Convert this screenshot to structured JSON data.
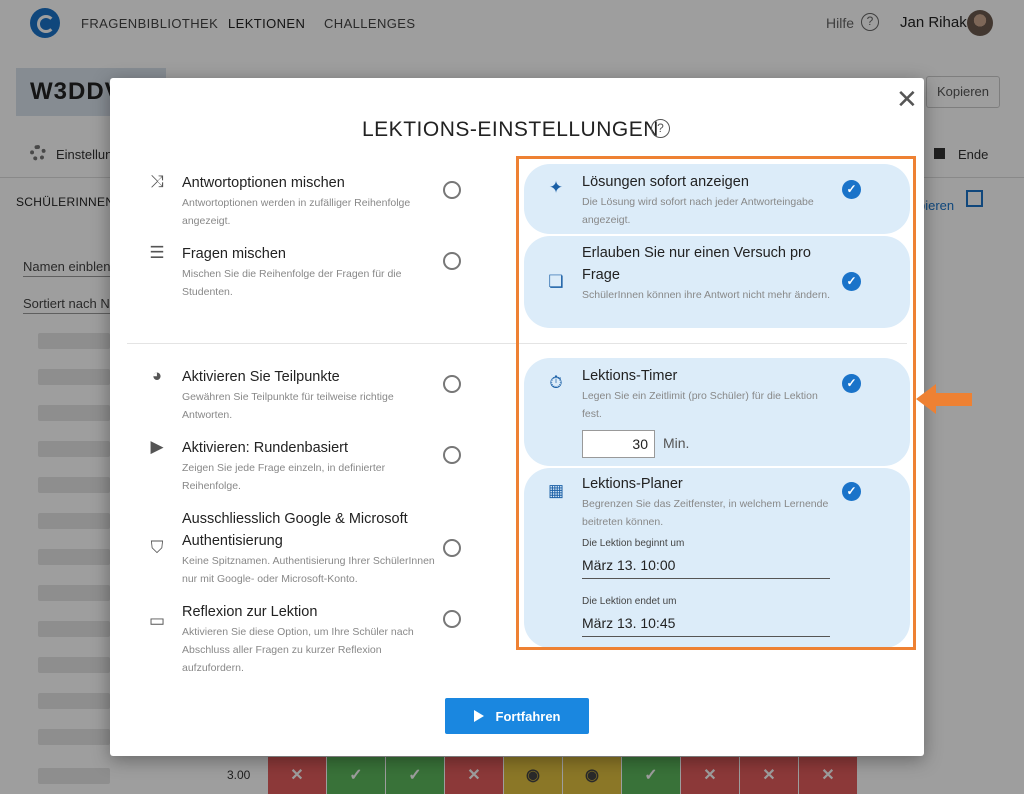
{
  "nav": {
    "links": [
      "FRAGENBIBLIOTHEK",
      "LEKTIONEN",
      "CHALLENGES"
    ],
    "help": "Hilfe",
    "user": "Jan Rihak"
  },
  "page": {
    "lesson_code": "W3DDV",
    "copy_button": "Kopieren",
    "settings_tab": "Einstellun",
    "end_label": "Ende",
    "students_header": "SCHÜLERINNEN",
    "copy_link": "pieren",
    "show_names": "Namen einblen",
    "sorted_by": "Sortiert nach Na",
    "score": "3.00",
    "results": [
      "wrong",
      "right",
      "right",
      "wrong",
      "seen",
      "seen",
      "right",
      "wrong",
      "wrong",
      "wrong"
    ]
  },
  "modal": {
    "title": "LEKTIONS-EINSTELLUNGEN",
    "left_options": [
      {
        "title": "Antwortoptionen mischen",
        "desc": "Antwortoptionen werden in zufälliger Reihenfolge angezeigt.",
        "icon": "shuffle-icon"
      },
      {
        "title": "Fragen mischen",
        "desc": "Mischen Sie die Reihenfolge der Fragen für die Studenten.",
        "icon": "playlist-remove-icon"
      },
      {
        "title": "Aktivieren Sie Teilpunkte",
        "desc": "Gewähren Sie Teilpunkte für teilweise richtige Antworten.",
        "icon": "pie-chart-icon"
      },
      {
        "title": "Aktivieren: Rundenbasiert",
        "desc": "Zeigen Sie jede Frage einzeln, in definierter Reihenfolge.",
        "icon": "play-circle-icon"
      },
      {
        "title": "Ausschliesslich Google & Microsoft Authentisierung",
        "desc": "Keine Spitznamen. Authentisierung Ihrer SchülerInnen nur mit Google- oder Microsoft-Konto.",
        "icon": "shield-check-icon"
      },
      {
        "title": "Reflexion zur Lektion",
        "desc": "Aktivieren Sie diese Option, um Ihre Schüler nach Abschluss aller Fragen zu kurzer Reflexion aufzufordern.",
        "icon": "chat-icon"
      }
    ],
    "right_options": [
      {
        "title": "Lösungen sofort anzeigen",
        "desc": "Die Lösung wird sofort nach jeder Antworteingabe angezeigt.",
        "icon": "sparkle-icon",
        "checked": true
      },
      {
        "title": "Erlauben Sie nur einen Versuch pro Frage",
        "desc": "SchülerInnen können ihre Antwort nicht mehr ändern.",
        "icon": "filter-one-icon",
        "checked": true
      },
      {
        "title": "Lektions-Timer",
        "desc": "Legen Sie ein Zeitlimit (pro Schüler) für die Lektion fest.",
        "icon": "timer-icon",
        "checked": true
      },
      {
        "title": "Lektions-Planer",
        "desc": "Begrenzen Sie das Zeitfenster, in welchem Lernende beitreten können.",
        "icon": "calendar-icon",
        "checked": true
      }
    ],
    "timer": {
      "value": "30",
      "unit": "Min."
    },
    "planner": {
      "start_label": "Die Lektion beginnt um",
      "start_value": "März 13. 10:00",
      "end_label": "Die Lektion endet um",
      "end_value": "März 13. 10:45"
    },
    "continue_button": "Fortfahren"
  },
  "colors": {
    "accent": "#1a73c9",
    "card_bg": "#dcecf9",
    "highlight": "#ee8133"
  }
}
